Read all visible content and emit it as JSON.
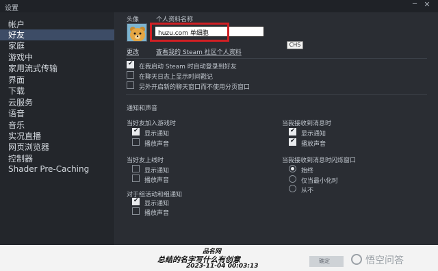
{
  "window": {
    "title": "设置"
  },
  "sidebar": {
    "items": [
      {
        "label": "帐户"
      },
      {
        "label": "好友"
      },
      {
        "label": "家庭"
      },
      {
        "label": "游戏中"
      },
      {
        "label": "家用流式传输"
      },
      {
        "label": "界面"
      },
      {
        "label": "下载"
      },
      {
        "label": "云服务"
      },
      {
        "label": "语音"
      },
      {
        "label": "音乐"
      },
      {
        "label": "实况直播"
      },
      {
        "label": "网页浏览器"
      },
      {
        "label": "控制器"
      },
      {
        "label": "Shader Pre-Caching"
      }
    ],
    "active_index": 1
  },
  "profile": {
    "avatar_label": "头像",
    "name_label": "个人资料名称",
    "name_value": "huzu.com 单细胞",
    "ime_indicator": "CHS",
    "change_link": "更改",
    "view_profile_link": "查看我的 Steam 社区个人资料"
  },
  "options": [
    {
      "label": "在我启动 Steam 时自动登录到好友",
      "checked": true
    },
    {
      "label": "在聊天日志上显示时间戳记",
      "checked": false
    },
    {
      "label": "另外开启新的聊天窗口而不使用分页窗口",
      "checked": false
    }
  ],
  "notifications": {
    "title": "通知和声音",
    "friend_join_game": {
      "title": "当好友加入游戏时",
      "show": {
        "label": "显示通知",
        "checked": true
      },
      "sound": {
        "label": "播放声音",
        "checked": false
      }
    },
    "friend_online": {
      "title": "当好友上线时",
      "show": {
        "label": "显示通知",
        "checked": false
      },
      "sound": {
        "label": "播放声音",
        "checked": false
      }
    },
    "group_events": {
      "title": "对于组活动和组通知",
      "show": {
        "label": "显示通知",
        "checked": true
      },
      "sound": {
        "label": "播放声音",
        "checked": false
      }
    },
    "receive_message": {
      "title": "当我接收到消息时",
      "show": {
        "label": "显示通知",
        "checked": true
      },
      "sound": {
        "label": "播放声音",
        "checked": true
      }
    },
    "flash_window": {
      "title": "当我接收到消息时闪烁窗口",
      "options": [
        {
          "label": "始终",
          "selected": true
        },
        {
          "label": "仅当最小化时",
          "selected": false
        },
        {
          "label": "从不",
          "selected": false
        }
      ]
    }
  },
  "footer": {
    "ok_button": "确定"
  },
  "caption": {
    "line1": "品名网",
    "line2": "总结的名字写什么有创意",
    "line3": "2023-11-04 00:03:13"
  },
  "watermark": {
    "text": "悟空问答"
  },
  "colors": {
    "active_item_bg": "#3d4c66",
    "highlight_border": "#d11f24"
  }
}
